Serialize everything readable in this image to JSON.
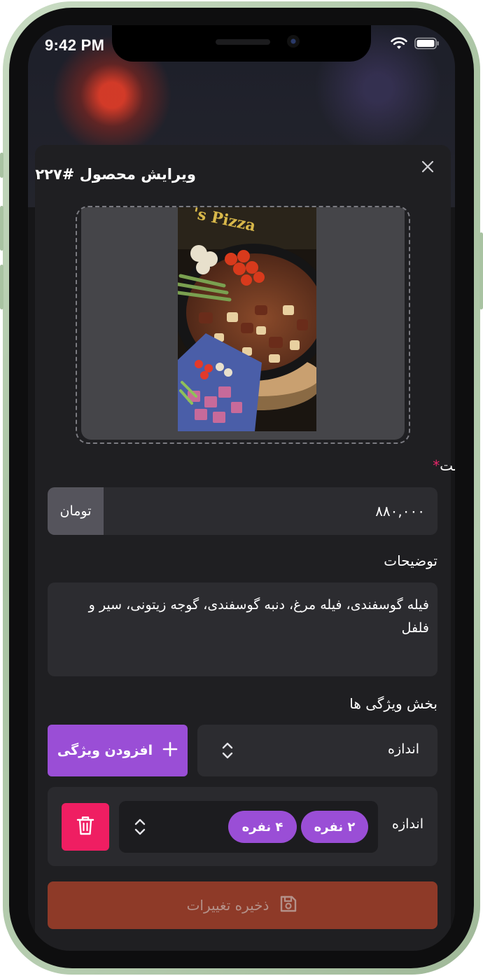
{
  "status_bar": {
    "time": "9:42 PM"
  },
  "modal": {
    "title": "ویرایش محصول #۲۲۷"
  },
  "price": {
    "label": "قیمت",
    "required_mark": "*",
    "value": "۸۸۰,۰۰۰",
    "unit": "تومان"
  },
  "description": {
    "label": "توضیحات",
    "value": "فیله گوسفندی، فیله مرغ، دنبه گوسفندی، گوجه زیتونی، سیر و فلفل"
  },
  "features": {
    "label": "بخش ویژگی ها",
    "selector_value": "اندازه",
    "add_button_label": "افزودن ویژگی",
    "items": [
      {
        "name": "اندازه",
        "options": [
          "۲ نفره",
          "۴ نفره"
        ]
      }
    ]
  },
  "save_button_label": "ذخیره تغییرات",
  "colors": {
    "accent_purple": "#9a4ed6",
    "delete_pink": "#ef1e62",
    "save_disabled": "#8e3a28",
    "modal_bg": "#1f1f22",
    "field_bg": "#2c2c30"
  },
  "icons": [
    "wifi-icon",
    "battery-icon",
    "close-icon",
    "chevron-updown-icon",
    "plus-icon",
    "trash-icon",
    "save-icon"
  ]
}
